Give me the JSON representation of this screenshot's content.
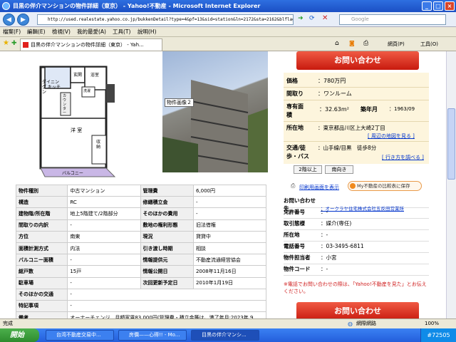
{
  "window": {
    "title": "目黒の伴介マンションの物件詳細（東京） - Yahoo!不動産 - Microsoft Internet Explorer"
  },
  "address": {
    "url": "http://used.realestate.yahoo.co.jp/bukkenDetail?type=4&pf=13&sid=station&ln=2172&sta=2162&blflag=0&code=02490000033478"
  },
  "search": {
    "placeholder": "Google"
  },
  "menu": [
    "檔案(F)",
    "編輯(E)",
    "檢視(V)",
    "我的最愛(A)",
    "工具(T)",
    "說明(H)"
  ],
  "tab": {
    "label": "目黒の伴介マンションの物件詳細（東京） - Yah..."
  },
  "tools": {
    "page": "網頁(P)",
    "tools": "工具(O)"
  },
  "photo": {
    "label": "物件画像２"
  },
  "floorplan": {
    "labels": [
      "玄関",
      "浴室",
      "ダイニング キッチン",
      "カウンター",
      "洗濯",
      "洋 室",
      "収納",
      "バルコニー"
    ]
  },
  "info": {
    "rows": [
      [
        "物件種別",
        "中古マンション",
        "管理費",
        "6,000円"
      ],
      [
        "構造",
        "RC",
        "修繕積立金",
        "-"
      ],
      [
        "建物階/所在階",
        "地上5階建て/2階部分",
        "そのほかの費用",
        "-"
      ],
      [
        "間取りの内訳",
        "-",
        "敷地の権利形態",
        "旧法借権"
      ],
      [
        "方位",
        "南東",
        "現況",
        "貸貸中"
      ],
      [
        "面積計測方式",
        "内法",
        "引き渡し時期",
        "相談"
      ],
      [
        "バルコニー面積",
        "-",
        "情報提供元",
        "不動産流通経営協会"
      ],
      [
        "総戸数",
        "15戸",
        "情報公開日",
        "2008年11月16日"
      ],
      [
        "駐車場",
        "-",
        "次回更新予定日",
        "2010年1月19日"
      ],
      [
        "そのほかの交通",
        "-",
        "",
        ""
      ],
      [
        "特記事項",
        "-",
        "",
        ""
      ],
      [
        "備考",
        "オーナーチェンジ　月額家賃83,000円(管理費・積立金等は、満了年月:2023年 9",
        "",
        ""
      ]
    ]
  },
  "right": {
    "inquiry": "お問い合わせ",
    "price_label": "価格",
    "price": "：780万円",
    "madori_label": "間取り",
    "madori": "：ワンルーム",
    "area_label": "専有面積",
    "area": "：32.63m²",
    "year_label": "築年月",
    "year": "：1963/09",
    "addr_label": "所在地",
    "addr": "：東京都品川区上大崎2丁目",
    "map_link": "[ 周辺の地図を見る ]",
    "traffic_label": "交通/徒歩・バス",
    "traffic": "：山手線/目黒　徒歩8分",
    "route_link": "[ 行き方を調べる ]",
    "btn_layout": "2階以上",
    "btn_south": "南向き",
    "print_link": "印刷用画面を表示",
    "save_btn": "My不動産の比較表に保存",
    "contact": [
      [
        "お問い合わせ先",
        "：オークラヤ住宅株式会社五反田営業所"
      ],
      [
        "免許番号",
        "：-"
      ],
      [
        "取引態様",
        "：媒介(専任)"
      ],
      [
        "所在地",
        "：-"
      ],
      [
        "電話番号",
        "：03-3495-6811"
      ],
      [
        "物件担当者",
        "：小宮"
      ],
      [
        "物件コード",
        "：-"
      ]
    ],
    "note": "※電話でお問い合わせの際は、「Yahoo!不動産を見た」とお伝えください。"
  },
  "status": {
    "text": "完成",
    "zone": "網際網路",
    "zoom": "100%"
  },
  "taskbar": {
    "start": "開始",
    "tasks": [
      "台湾不動産交易中...",
      "房價——心得!! - Mo...",
      "目黒の伴介マンシ..."
    ],
    "tray": "#72505"
  }
}
